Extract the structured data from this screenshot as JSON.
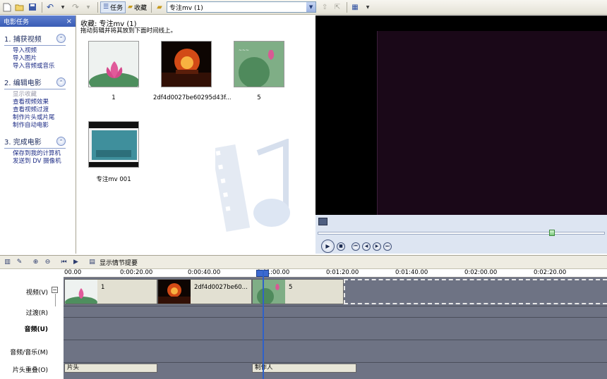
{
  "toolbar": {
    "tasks_label": "任务",
    "collections_label": "收藏",
    "collection_select": "专注mv (1)"
  },
  "taskpane": {
    "title": "电影任务",
    "close": "×",
    "sections": [
      {
        "title": "1. 捕获视频",
        "links": [
          "导入视频",
          "导入图片",
          "导入音频或音乐"
        ]
      },
      {
        "title": "2. 编辑电影",
        "links": [
          "显示收藏",
          "查看视频效果",
          "查看视频过渡",
          "制作片头或片尾",
          "制作自动电影"
        ]
      },
      {
        "title": "3. 完成电影",
        "links": [
          "保存到我的计算机",
          "发送到 DV 摄像机"
        ]
      }
    ]
  },
  "collection": {
    "title": "收藏: 专注mv (1)",
    "hint": "拖动剪辑并将其放到下面时间线上。",
    "clips": [
      {
        "caption": "1"
      },
      {
        "caption": "2df4d0027be60295d43f..."
      },
      {
        "caption": "5"
      },
      {
        "caption": "专注mv 001"
      }
    ]
  },
  "timeline": {
    "storyboard_label": "显示情节提要",
    "ruler": [
      "00.00",
      "0:00:20.00",
      "0:00:40.00",
      "0:01:00.00",
      "0:01:20.00",
      "0:01:40.00",
      "0:02:00.00",
      "0:02:20.00"
    ],
    "tracks": {
      "video": "视频(V)",
      "transition": "过渡(R)",
      "audio": "音频(U)",
      "audio_music": "音频/音乐(M)",
      "title_overlay": "片头重叠(O)"
    },
    "video_clips": [
      {
        "name": "1"
      },
      {
        "name": "2df4d0027be60..."
      },
      {
        "name": "5"
      }
    ],
    "title_clips": [
      "片头",
      "制作人"
    ]
  },
  "colors": {
    "taskpane_header": "#3a5db5",
    "timeline_track": "#6e7384",
    "playhead": "#2f61c9"
  }
}
